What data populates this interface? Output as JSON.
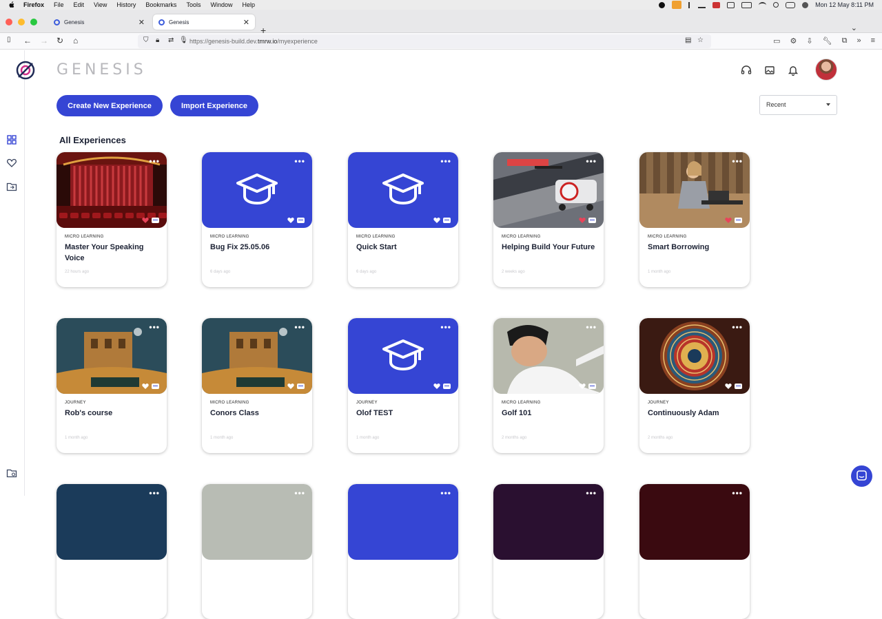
{
  "menubar": {
    "app": "Firefox",
    "items": [
      "File",
      "Edit",
      "View",
      "History",
      "Bookmarks",
      "Tools",
      "Window",
      "Help"
    ],
    "datetime": "Mon 12 May  8:11 PM"
  },
  "tabs": [
    {
      "title": "Genesis",
      "active": false
    },
    {
      "title": "Genesis",
      "active": true
    }
  ],
  "url": {
    "prefix": "https://genesis-build.dev.",
    "domain": "tmrw.io",
    "path": "/myexperience"
  },
  "brand": {
    "wordmark": "GENESIS",
    "accent": "#3545d4"
  },
  "actions": {
    "create": "Create New Experience",
    "import": "Import Experience"
  },
  "sort": {
    "selected": "Recent"
  },
  "section_title": "All Experiences",
  "cards": [
    {
      "type": "MICRO LEARNING",
      "title": "Master Your Speaking Voice",
      "date": "22 hours ago",
      "thumb": "theater",
      "liked": true
    },
    {
      "type": "MICRO LEARNING",
      "title": "Bug Fix 25.05.06",
      "date": "6 days ago",
      "thumb": "blue",
      "liked": false
    },
    {
      "type": "MICRO LEARNING",
      "title": "Quick Start",
      "date": "6 days ago",
      "thumb": "blue",
      "liked": false
    },
    {
      "type": "MICRO LEARNING",
      "title": "Helping Build Your Future",
      "date": "2 weeks ago",
      "thumb": "construction",
      "liked": true
    },
    {
      "type": "MICRO LEARNING",
      "title": "Smart Borrowing",
      "date": "1 month ago",
      "thumb": "cafe",
      "liked": true
    },
    {
      "type": "JOURNEY",
      "title": "Rob's course",
      "date": "1 month ago",
      "thumb": "desert",
      "liked": false
    },
    {
      "type": "MICRO LEARNING",
      "title": "Conors Class",
      "date": "1 month ago",
      "thumb": "desert",
      "liked": false
    },
    {
      "type": "JOURNEY",
      "title": "Olof TEST",
      "date": "1 month ago",
      "thumb": "blue",
      "liked": false
    },
    {
      "type": "MICRO LEARNING",
      "title": "Golf 101",
      "date": "2 months ago",
      "thumb": "golf",
      "liked": false
    },
    {
      "type": "JOURNEY",
      "title": "Continuously Adam",
      "date": "2 months ago",
      "thumb": "mandala",
      "liked": false
    }
  ],
  "icons": {
    "sidebar": [
      "grid-icon",
      "heart-icon",
      "folder-icon",
      "folder-settings-icon"
    ],
    "header": [
      "headset-icon",
      "image-gallery-icon",
      "bell-icon"
    ]
  }
}
